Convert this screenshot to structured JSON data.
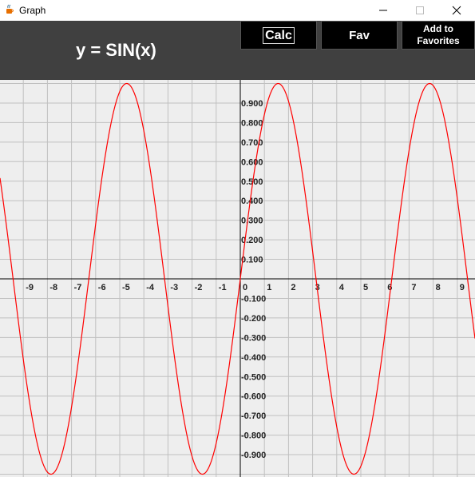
{
  "window": {
    "title": "Graph"
  },
  "header": {
    "formula": "y = SIN(x)",
    "calc_label": "Calc",
    "fav_label": "Fav",
    "add_fav_line1": "Add to",
    "add_fav_line2": "Favorites"
  },
  "icons": {
    "app": "java-cup-icon",
    "minimize": "minimize-icon",
    "maximize": "maximize-icon",
    "close": "close-icon"
  },
  "colors": {
    "curve": "#ff0000",
    "grid": "#c0c0c0",
    "axis": "#000000",
    "header_bg": "#404040",
    "plot_bg": "#eeeeee"
  },
  "chart_data": {
    "type": "line",
    "function": "sin",
    "xlim": [
      -10,
      9.8
    ],
    "ylim": [
      -1,
      1
    ],
    "grid": true,
    "series": [
      {
        "name": "y = SIN(x)",
        "color": "#ff0000"
      }
    ],
    "x_ticks": [
      "-9",
      "-8",
      "-7",
      "-6",
      "-5",
      "-4",
      "-3",
      "-2",
      "-1",
      "0",
      "1",
      "2",
      "3",
      "4",
      "5",
      "6",
      "7",
      "8",
      "9"
    ],
    "y_ticks": [
      "0.900",
      "0.800",
      "0.700",
      "0.600",
      "0.500",
      "0.400",
      "0.300",
      "0.200",
      "0.100",
      "-0.100",
      "-0.200",
      "-0.300",
      "-0.400",
      "-0.500",
      "-0.600",
      "-0.700",
      "-0.800",
      "-0.900"
    ]
  }
}
